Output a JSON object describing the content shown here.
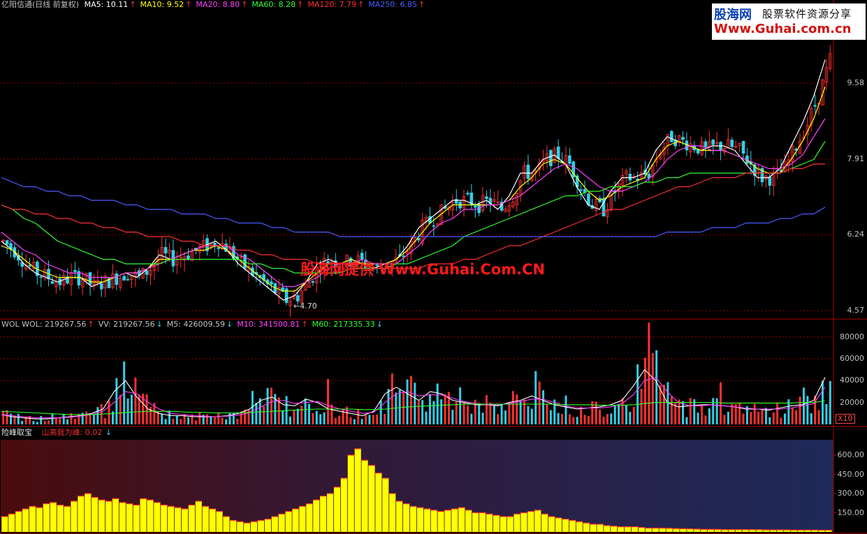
{
  "header": {
    "stock_name": "亿阳信通(日线 前复权)",
    "ma_items": [
      {
        "label": "MA5: 10.11",
        "color": "#ffffff",
        "arrow": "↑",
        "arrow_color": "#ff3030"
      },
      {
        "label": "MA10: 9.52",
        "color": "#ffff00",
        "arrow": "↑",
        "arrow_color": "#ff3030"
      },
      {
        "label": "MA20: 8.80",
        "color": "#ff40ff",
        "arrow": "↑",
        "arrow_color": "#ff3030"
      },
      {
        "label": "MA60: 8.28",
        "color": "#30ff30",
        "arrow": "↑",
        "arrow_color": "#ff3030"
      },
      {
        "label": "MA120: 7.79",
        "color": "#ff3030",
        "arrow": "↑",
        "arrow_color": "#ff3030"
      },
      {
        "label": "MA250: 6.85",
        "color": "#4a5cff",
        "arrow": "↑",
        "arrow_color": "#ff3030"
      }
    ]
  },
  "volume_header": {
    "items": [
      {
        "label": "WOL  WOL: 219267.56",
        "color": "#c0c0c0",
        "arrow": "↑",
        "arrow_color": "#ff3030"
      },
      {
        "label": "VV: 219267.56",
        "color": "#c0c0c0",
        "arrow": "↓",
        "arrow_color": "#30d0ff"
      },
      {
        "label": "M5: 426009.59",
        "color": "#c0c0c0",
        "arrow": "↓",
        "arrow_color": "#30d0ff"
      },
      {
        "label": "M10: 341500.81",
        "color": "#ff40ff",
        "arrow": "↑",
        "arrow_color": "#ff3030"
      },
      {
        "label": "M60: 217335.33",
        "color": "#30ff30",
        "arrow": "↓",
        "arrow_color": "#30d0ff"
      }
    ]
  },
  "indicator_header": {
    "name": "险峰取宝",
    "line_label": "山高我为峰: 0.02",
    "line_color": "#ff3030",
    "arrow": "↓",
    "arrow_color": "#30d0ff"
  },
  "watermark": {
    "brand": "股海网",
    "tagline": "股票软件资源分享",
    "url": "Www.Guhai.com.cn"
  },
  "center_watermark": "股海网提供 Www.Guhai.Com.CN",
  "low_marker": "←4.70",
  "x10_label": "X10",
  "colors": {
    "up": "#ff3030",
    "down": "#30d0e8",
    "ma5": "#ffffff",
    "ma10": "#ffff00",
    "ma20": "#ff40ff",
    "ma60": "#30ff30",
    "ma120": "#ff3030",
    "ma250": "#4a5cff",
    "grid": "#8b0000",
    "indicator_bar": "#ffff00"
  },
  "chart_data": [
    {
      "type": "candlestick",
      "panel": "price",
      "y_ticks": [
        "9.58",
        "7.91",
        "6.24",
        "4.57"
      ],
      "y_tick_values": [
        9.58,
        7.91,
        6.24,
        4.57
      ],
      "ylim": [
        4.4,
        11.2
      ],
      "n_bars": 220,
      "low_marker_value": 4.7,
      "series": [
        {
          "name": "MA5",
          "color": "#ffffff",
          "values": [
            6.1,
            5.9,
            5.6,
            5.4,
            5.3,
            5.2,
            5.3,
            5.3,
            5.1,
            5.2,
            5.3,
            5.4,
            5.3,
            5.5,
            5.8,
            5.7,
            5.8,
            5.9,
            6.0,
            6.1,
            5.9,
            5.6,
            5.4,
            5.2,
            5.0,
            4.8,
            4.9,
            5.2,
            5.6,
            5.7,
            5.6,
            5.7,
            5.6,
            5.5,
            5.6,
            5.7,
            6.0,
            6.4,
            6.6,
            6.8,
            7.0,
            7.0,
            6.9,
            7.0,
            6.8,
            7.1,
            7.6,
            7.6,
            7.9,
            8.0,
            7.8,
            7.3,
            6.9,
            6.8,
            7.2,
            7.5,
            7.5,
            7.6,
            8.1,
            8.4,
            8.3,
            8.2,
            8.1,
            8.2,
            8.2,
            8.1,
            7.8,
            7.5,
            7.5,
            7.7,
            8.2,
            8.7,
            9.3,
            10.1
          ]
        },
        {
          "name": "MA10",
          "color": "#ffff00",
          "values": [
            6.0,
            5.9,
            5.7,
            5.5,
            5.4,
            5.3,
            5.3,
            5.3,
            5.2,
            5.2,
            5.3,
            5.4,
            5.4,
            5.5,
            5.7,
            5.7,
            5.8,
            5.9,
            5.9,
            6.0,
            5.9,
            5.7,
            5.5,
            5.3,
            5.1,
            5.0,
            5.0,
            5.2,
            5.4,
            5.6,
            5.6,
            5.7,
            5.6,
            5.6,
            5.6,
            5.7,
            5.9,
            6.2,
            6.5,
            6.7,
            6.9,
            6.9,
            6.9,
            6.9,
            6.9,
            7.0,
            7.3,
            7.5,
            7.8,
            7.9,
            7.8,
            7.5,
            7.2,
            7.0,
            7.1,
            7.3,
            7.4,
            7.5,
            7.9,
            8.2,
            8.3,
            8.2,
            8.1,
            8.1,
            8.1,
            8.0,
            7.9,
            7.7,
            7.6,
            7.6,
            7.9,
            8.3,
            8.8,
            9.5
          ]
        },
        {
          "name": "MA20",
          "color": "#ff40ff",
          "values": [
            6.3,
            6.1,
            5.9,
            5.8,
            5.6,
            5.5,
            5.4,
            5.4,
            5.3,
            5.3,
            5.3,
            5.4,
            5.4,
            5.5,
            5.6,
            5.7,
            5.8,
            5.9,
            6.0,
            6.0,
            6.0,
            5.8,
            5.7,
            5.5,
            5.3,
            5.1,
            5.1,
            5.2,
            5.3,
            5.5,
            5.6,
            5.6,
            5.7,
            5.6,
            5.6,
            5.6,
            5.8,
            6.0,
            6.3,
            6.5,
            6.6,
            6.8,
            6.8,
            6.9,
            6.9,
            7.0,
            7.1,
            7.3,
            7.5,
            7.7,
            7.8,
            7.7,
            7.5,
            7.3,
            7.2,
            7.2,
            7.3,
            7.4,
            7.6,
            7.9,
            8.1,
            8.2,
            8.2,
            8.1,
            8.1,
            8.0,
            7.9,
            7.8,
            7.7,
            7.7,
            7.8,
            8.0,
            8.4,
            8.8
          ]
        },
        {
          "name": "MA60",
          "color": "#30ff30",
          "values": [
            6.9,
            6.8,
            6.6,
            6.5,
            6.3,
            6.1,
            6.0,
            5.9,
            5.8,
            5.7,
            5.7,
            5.6,
            5.6,
            5.6,
            5.6,
            5.7,
            5.7,
            5.7,
            5.7,
            5.7,
            5.7,
            5.7,
            5.6,
            5.6,
            5.5,
            5.5,
            5.4,
            5.4,
            5.4,
            5.4,
            5.4,
            5.5,
            5.5,
            5.5,
            5.5,
            5.6,
            5.6,
            5.7,
            5.8,
            5.9,
            6.0,
            6.2,
            6.3,
            6.4,
            6.5,
            6.6,
            6.7,
            6.8,
            6.9,
            7.0,
            7.1,
            7.1,
            7.2,
            7.2,
            7.3,
            7.3,
            7.3,
            7.4,
            7.4,
            7.5,
            7.5,
            7.6,
            7.6,
            7.6,
            7.6,
            7.6,
            7.6,
            7.6,
            7.6,
            7.6,
            7.7,
            7.8,
            7.9,
            8.3
          ]
        },
        {
          "name": "MA120",
          "color": "#ff3030",
          "values": [
            6.9,
            6.8,
            6.8,
            6.7,
            6.7,
            6.6,
            6.6,
            6.5,
            6.5,
            6.4,
            6.4,
            6.3,
            6.3,
            6.2,
            6.2,
            6.2,
            6.1,
            6.1,
            6.0,
            6.0,
            6.0,
            5.9,
            5.9,
            5.8,
            5.8,
            5.7,
            5.7,
            5.7,
            5.6,
            5.6,
            5.6,
            5.6,
            5.6,
            5.5,
            5.5,
            5.5,
            5.5,
            5.5,
            5.6,
            5.6,
            5.6,
            5.7,
            5.7,
            5.8,
            5.9,
            6.0,
            6.0,
            6.1,
            6.2,
            6.3,
            6.4,
            6.5,
            6.6,
            6.7,
            6.8,
            6.8,
            6.9,
            7.0,
            7.1,
            7.2,
            7.3,
            7.3,
            7.4,
            7.5,
            7.5,
            7.5,
            7.6,
            7.6,
            7.6,
            7.6,
            7.7,
            7.7,
            7.8,
            7.8
          ]
        },
        {
          "name": "MA250",
          "color": "#4a5cff",
          "values": [
            7.5,
            7.4,
            7.3,
            7.3,
            7.2,
            7.2,
            7.1,
            7.1,
            7.0,
            7.0,
            7.0,
            6.9,
            6.9,
            6.8,
            6.8,
            6.8,
            6.7,
            6.7,
            6.7,
            6.6,
            6.6,
            6.5,
            6.5,
            6.5,
            6.4,
            6.4,
            6.3,
            6.3,
            6.3,
            6.3,
            6.2,
            6.2,
            6.2,
            6.2,
            6.2,
            6.2,
            6.2,
            6.2,
            6.2,
            6.2,
            6.2,
            6.2,
            6.2,
            6.2,
            6.2,
            6.2,
            6.2,
            6.2,
            6.2,
            6.2,
            6.2,
            6.2,
            6.2,
            6.2,
            6.2,
            6.2,
            6.2,
            6.2,
            6.2,
            6.3,
            6.3,
            6.3,
            6.3,
            6.4,
            6.4,
            6.4,
            6.5,
            6.5,
            6.5,
            6.6,
            6.6,
            6.7,
            6.7,
            6.85
          ]
        }
      ]
    },
    {
      "type": "bar",
      "panel": "volume",
      "y_ticks": [
        "80000",
        "60000",
        "40000",
        "20000"
      ],
      "y_tick_values": [
        80000,
        60000,
        40000,
        20000
      ],
      "ylim": [
        0,
        88000
      ],
      "unit_multiplier": "X10",
      "series": [
        {
          "name": "M5",
          "color": "#ffffff",
          "values": [
            9000,
            7000,
            6000,
            5000,
            5000,
            6000,
            7000,
            8000,
            10000,
            14000,
            30000,
            40000,
            25000,
            14000,
            10000,
            8000,
            8000,
            7000,
            7000,
            7000,
            8000,
            10000,
            14000,
            22000,
            25000,
            18000,
            17000,
            23000,
            20000,
            14000,
            12000,
            10000,
            8000,
            12000,
            28000,
            34000,
            28000,
            22000,
            30000,
            28000,
            22000,
            20000,
            18000,
            18000,
            17000,
            20000,
            22000,
            26000,
            22000,
            18000,
            16000,
            14000,
            15000,
            16000,
            18000,
            22000,
            35000,
            50000,
            40000,
            20000,
            16000,
            17000,
            18000,
            18000,
            17000,
            16000,
            14000,
            14000,
            13000,
            15000,
            17000,
            18000,
            22000,
            43000
          ]
        },
        {
          "name": "M10",
          "color": "#ff40ff",
          "values": [
            9000,
            8000,
            7000,
            6000,
            6000,
            6000,
            6500,
            7500,
            9000,
            12000,
            20000,
            30000,
            28000,
            20000,
            14000,
            10000,
            9000,
            8000,
            7500,
            7000,
            7500,
            8500,
            11000,
            16000,
            21000,
            22000,
            19000,
            20000,
            21000,
            17000,
            14000,
            12000,
            10000,
            11000,
            20000,
            28000,
            30000,
            26000,
            27000,
            27000,
            24000,
            21000,
            19000,
            18000,
            18000,
            19000,
            21000,
            23000,
            23000,
            20000,
            17000,
            15000,
            15000,
            15000,
            16000,
            19000,
            27000,
            40000,
            43000,
            30000,
            20000,
            17000,
            17000,
            18000,
            17000,
            16000,
            15000,
            14000,
            14000,
            14000,
            15000,
            17000,
            19000,
            34000
          ]
        },
        {
          "name": "M60",
          "color": "#30ff30",
          "values": [
            12000,
            11500,
            11000,
            10500,
            10000,
            9500,
            9000,
            9000,
            9000,
            9500,
            10000,
            11000,
            11500,
            12000,
            12000,
            12000,
            11500,
            11000,
            11000,
            10500,
            10500,
            10500,
            11000,
            11500,
            12000,
            12500,
            13000,
            13500,
            14000,
            14000,
            14000,
            14000,
            13500,
            13500,
            14000,
            15000,
            16000,
            16500,
            17000,
            17500,
            18000,
            18500,
            18500,
            18500,
            18500,
            18500,
            18500,
            18500,
            18500,
            18500,
            18000,
            18000,
            18000,
            17500,
            17500,
            17500,
            18000,
            19000,
            20000,
            20000,
            20000,
            20000,
            20000,
            20000,
            19500,
            19500,
            19500,
            19500,
            19500,
            19500,
            19500,
            20000,
            20000,
            21700
          ]
        }
      ]
    },
    {
      "type": "bar",
      "panel": "indicator",
      "title": "险峰取宝",
      "y_ticks": [
        "600.00",
        "450.00",
        "300.00",
        "150.00"
      ],
      "y_tick_values": [
        600,
        450,
        300,
        150
      ],
      "ylim": [
        0,
        720
      ],
      "series": [
        {
          "name": "山高我为峰",
          "color": "#ffff00",
          "values": [
            120,
            140,
            160,
            180,
            200,
            190,
            220,
            230,
            210,
            200,
            240,
            280,
            300,
            270,
            250,
            240,
            260,
            230,
            220,
            210,
            260,
            250,
            230,
            210,
            200,
            190,
            180,
            210,
            240,
            200,
            180,
            160,
            120,
            90,
            80,
            70,
            80,
            90,
            100,
            120,
            140,
            160,
            180,
            200,
            220,
            250,
            280,
            300,
            350,
            420,
            600,
            650,
            560,
            520,
            460,
            420,
            300,
            240,
            220,
            200,
            190,
            180,
            170,
            160,
            170,
            180,
            190,
            170,
            150,
            150,
            140,
            130,
            120,
            120,
            140,
            150,
            160,
            170,
            140,
            120,
            110,
            100,
            90,
            80,
            70,
            60,
            60,
            50,
            45,
            40,
            40,
            40,
            35,
            30,
            30,
            30,
            28,
            26,
            25,
            24,
            22,
            20,
            20,
            20,
            18,
            18,
            18,
            18,
            18,
            18,
            16,
            16,
            16,
            16,
            15,
            15,
            15,
            15,
            14,
            14
          ]
        }
      ]
    }
  ]
}
